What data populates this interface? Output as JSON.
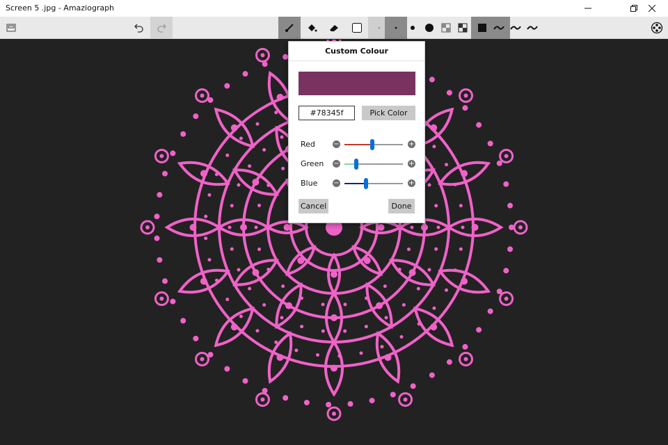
{
  "window": {
    "title": "Screen 5 .jpg - Amaziograph"
  },
  "toolbar": {
    "icons": [
      "save-icon",
      "undo-icon",
      "redo-icon",
      "brush-icon",
      "fill-icon",
      "eraser-icon",
      "color-swatch-icon",
      "tiny-dot-icon",
      "small-dot-icon",
      "medium-dot-icon",
      "large-dot-icon",
      "opacity-low-icon",
      "opacity-mid-icon",
      "opacity-full-icon",
      "smooth-stroke-icon",
      "stroke-mid-icon",
      "stroke-rough-icon",
      "symmetry-icon"
    ]
  },
  "dialog": {
    "title": "Custom Colour",
    "hex_value": "#78345f",
    "swatch_color": "#78345f",
    "pick_label": "Pick Color",
    "sliders": [
      {
        "label": "Red",
        "minus": "−",
        "plus": "+",
        "value": 120,
        "color": "#c0392b"
      },
      {
        "label": "Green",
        "minus": "−",
        "plus": "+",
        "value": 52,
        "color": "#7fd89a"
      },
      {
        "label": "Blue",
        "minus": "−",
        "plus": "+",
        "value": 95,
        "color": "#1a237e"
      }
    ],
    "cancel_label": "Cancel",
    "done_label": "Done"
  },
  "colors": {
    "mandala": "#f062c8",
    "background": "#222222"
  }
}
